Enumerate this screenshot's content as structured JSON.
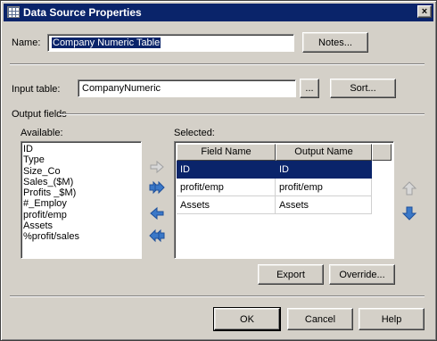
{
  "title": "Data Source Properties",
  "name": {
    "label": "Name:",
    "value": "Company Numeric Table"
  },
  "buttons": {
    "notes": "Notes...",
    "browse": "...",
    "sort": "Sort...",
    "export": "Export",
    "override": "Override...",
    "ok": "OK",
    "cancel": "Cancel",
    "help": "Help",
    "close": "×"
  },
  "input_table": {
    "label": "Input table:",
    "value": "CompanyNumeric"
  },
  "output_fields": {
    "group_label": "Output fields",
    "available_label": "Available:",
    "selected_label": "Selected:",
    "available": [
      "ID",
      "Type",
      "Size_Co",
      "Sales_($M)",
      "Profits _$M)",
      "#_Employ",
      "profit/emp",
      "Assets",
      "%profit/sales"
    ],
    "columns": [
      "Field Name",
      "Output Name"
    ],
    "rows": [
      [
        "ID",
        "ID"
      ],
      [
        "profit/emp",
        "profit/emp"
      ],
      [
        "Assets",
        "Assets"
      ]
    ]
  },
  "icons": {
    "add": "arrow-right-icon",
    "add_all": "double-arrow-right-icon",
    "remove": "arrow-left-icon",
    "remove_all": "double-arrow-left-icon",
    "move_up": "arrow-up-icon",
    "move_down": "arrow-down-icon"
  },
  "colors": {
    "titlebar": "#0a246a",
    "selection": "#0a246a",
    "face": "#d4d0c8",
    "arrow_blue": "#3a78c8"
  }
}
